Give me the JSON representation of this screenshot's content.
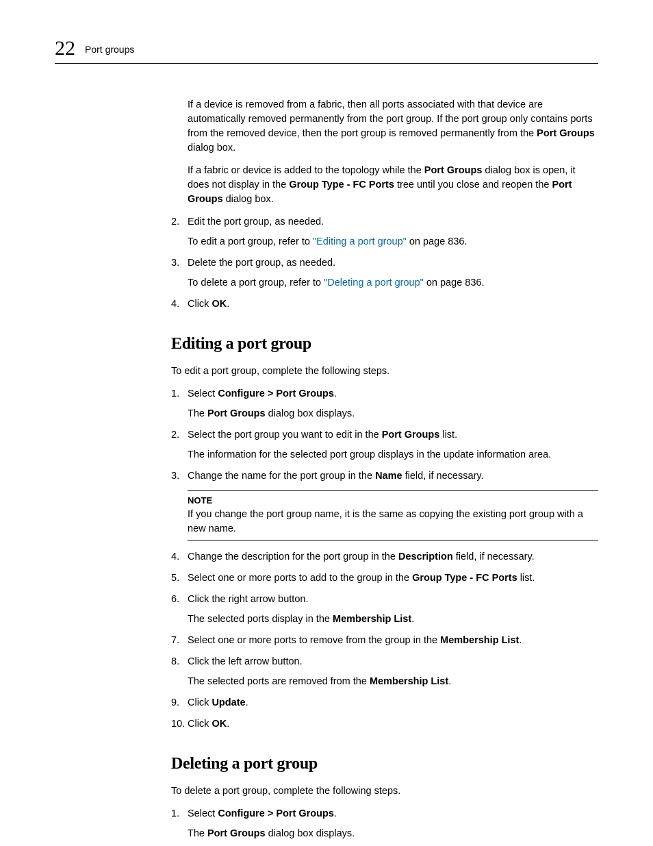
{
  "header": {
    "chapter_number": "22",
    "section_title": "Port groups"
  },
  "intro": {
    "p1a": "If a device is removed from a fabric, then all ports associated with that device are automatically removed permanently from the port group. If the port group only contains ports from the removed device, then the port group is removed permanently from the ",
    "p1b": "Port Groups",
    "p1c": " dialog box.",
    "p2a": "If a fabric or device is added to the topology while the ",
    "p2b": "Port Groups",
    "p2c": " dialog box is open, it does not display in the ",
    "p2d": "Group Type - FC Ports",
    "p2e": " tree until you close and reopen the ",
    "p2f": "Port Groups",
    "p2g": " dialog box."
  },
  "steps_top": {
    "s2": {
      "num": "2.",
      "text": "Edit the port group, as needed.",
      "sub_a": "To edit a port group, refer to ",
      "sub_link": "\"Editing a port group\"",
      "sub_b": " on page 836."
    },
    "s3": {
      "num": "3.",
      "text": "Delete the port group, as needed.",
      "sub_a": "To delete a port group, refer to ",
      "sub_link": "\"Deleting a port group\"",
      "sub_b": " on page 836."
    },
    "s4": {
      "num": "4.",
      "a": "Click ",
      "b": "OK",
      "c": "."
    }
  },
  "editing": {
    "heading": "Editing a port group",
    "intro": "To edit a port group, complete the following steps.",
    "s1": {
      "num": "1.",
      "a": "Select ",
      "b": "Configure > Port Groups",
      "c": ".",
      "sub_a": "The ",
      "sub_b": "Port Groups",
      "sub_c": " dialog box displays."
    },
    "s2": {
      "num": "2.",
      "a": "Select the port group you want to edit in the ",
      "b": "Port Groups",
      "c": " list.",
      "sub": "The information for the selected port group displays in the update information area."
    },
    "s3": {
      "num": "3.",
      "a": "Change the name for the port group in the ",
      "b": "Name",
      "c": " field, if necessary."
    },
    "note": {
      "label": "NOTE",
      "text": "If you change the port group name, it is the same as copying the existing port group with a new name."
    },
    "s4": {
      "num": "4.",
      "a": "Change the description for the port group in the ",
      "b": "Description",
      "c": " field, if necessary."
    },
    "s5": {
      "num": "5.",
      "a": "Select one or more ports to add to the group in the ",
      "b": "Group Type - FC Ports",
      "c": " list."
    },
    "s6": {
      "num": "6.",
      "text": "Click the right arrow button.",
      "sub_a": "The selected ports display in the ",
      "sub_b": "Membership List",
      "sub_c": "."
    },
    "s7": {
      "num": "7.",
      "a": "Select one or more ports to remove from the group in the ",
      "b": "Membership List",
      "c": "."
    },
    "s8": {
      "num": "8.",
      "text": "Click the left arrow button.",
      "sub_a": "The selected ports are removed from the ",
      "sub_b": "Membership List",
      "sub_c": "."
    },
    "s9": {
      "num": "9.",
      "a": "Click ",
      "b": "Update",
      "c": "."
    },
    "s10": {
      "num": "10.",
      "a": "Click ",
      "b": "OK",
      "c": "."
    }
  },
  "deleting": {
    "heading": "Deleting a port group",
    "intro": "To delete a port group, complete the following steps.",
    "s1": {
      "num": "1.",
      "a": "Select ",
      "b": "Configure > Port Groups",
      "c": ".",
      "sub_a": "The ",
      "sub_b": "Port Groups",
      "sub_c": " dialog box displays."
    }
  }
}
